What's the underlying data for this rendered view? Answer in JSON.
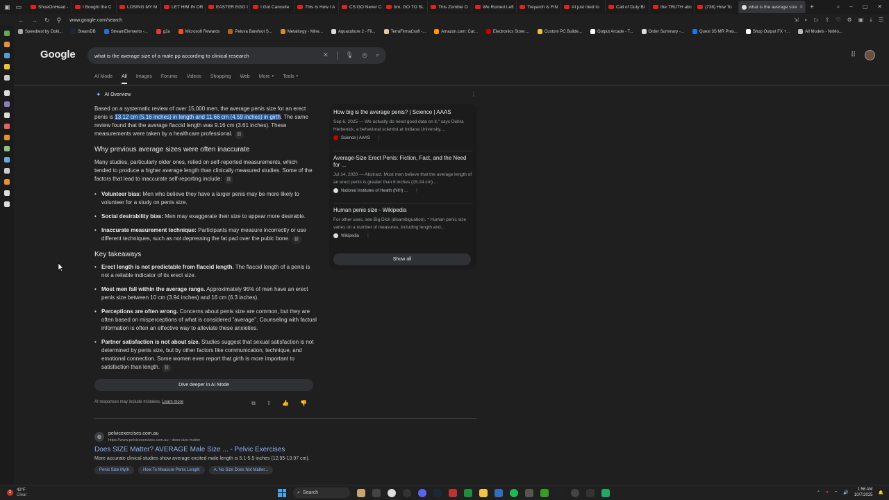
{
  "browser": {
    "tabs": [
      {
        "label": "ShoeOnHead -",
        "icon": "youtube-icon"
      },
      {
        "label": "I Bought the C",
        "icon": "youtube-icon"
      },
      {
        "label": "LOSING MY M",
        "icon": "youtube-icon"
      },
      {
        "label": "LET HIM IN OR",
        "icon": "youtube-icon"
      },
      {
        "label": "EASTER EGG I",
        "icon": "youtube-icon"
      },
      {
        "label": "I Got Cancelle",
        "icon": "youtube-icon"
      },
      {
        "label": "This Is How I A",
        "icon": "youtube-icon"
      },
      {
        "label": "CS:GO Never C",
        "icon": "youtube-icon"
      },
      {
        "label": "bro, GO TO SL",
        "icon": "youtube-icon"
      },
      {
        "label": "This Zombie O",
        "icon": "youtube-icon"
      },
      {
        "label": "We Ruined Left",
        "icon": "youtube-icon"
      },
      {
        "label": "Treyarch is FIN",
        "icon": "youtube-icon"
      },
      {
        "label": "AI just tried to",
        "icon": "youtube-icon"
      },
      {
        "label": "Call of Duty Bl",
        "icon": "youtube-icon"
      },
      {
        "label": "the TRUTH abc",
        "icon": "youtube-icon"
      },
      {
        "label": "(738) How To",
        "icon": "youtube-icon"
      },
      {
        "label": "what is the average size",
        "icon": "google-icon",
        "active": true
      }
    ],
    "url": "www.google.com/search",
    "bookmarks": [
      "Speedtest by Ookl...",
      "SteamDB",
      "StreamElements -...",
      "g2a",
      "Microsoft Rewards",
      "Peluva Barefoot S...",
      "Metallurgy - Mine...",
      "Aquaculture 2 - Fil...",
      "TerraFirmaCraft -...",
      "Amazon.com: Cat...",
      "Electronics Store:...",
      "Custom PC Builde...",
      "Output Arcade - T...",
      "Order Summary -...",
      "Quest 3S MR Pres...",
      "Shop Output FX +...",
      "All Models - NxMo..."
    ]
  },
  "google": {
    "logo": "Google",
    "query": "what is the average size of a male pp according to clinical research",
    "tabs": [
      "AI Mode",
      "All",
      "Images",
      "Forums",
      "Videos",
      "Shopping",
      "Web",
      "More",
      "Tools"
    ],
    "active_tab": "All"
  },
  "ai_overview": {
    "label": "AI Overview",
    "intro_before": "Based on a systematic review of over 15,000 men, the average penis size for an erect penis is ",
    "intro_highlight": "13.12 cm (5.16 inches) in length and 11.66 cm (4.59 inches) in girth",
    "intro_after": ". The same review found that the average flaccid length was 9.16 cm (3.61 inches). These measurements were taken by a healthcare professional.",
    "section1_title": "Why previous average sizes were often inaccurate",
    "section1_text": "Many studies, particularly older ones, relied on self-reported measurements, which tended to produce a higher average length than clinically measured studies. Some of the factors that lead to inaccurate self-reporting include:",
    "bias_items": [
      {
        "bold": "Volunteer bias:",
        "text": " Men who believe they have a larger penis may be more likely to volunteer for a study on penis size."
      },
      {
        "bold": "Social desirability bias:",
        "text": " Men may exaggerate their size to appear more desirable."
      },
      {
        "bold": "Inaccurate measurement technique:",
        "text": " Participants may measure incorrectly or use different techniques, such as not depressing the fat pad over the pubic bone."
      }
    ],
    "section2_title": "Key takeaways",
    "takeaways": [
      {
        "bold": "Erect length is not predictable from flaccid length.",
        "text": " The flaccid length of a penis is not a reliable indicator of its erect size."
      },
      {
        "bold": "Most men fall within the average range.",
        "text": " Approximately 95% of men have an erect penis size between 10 cm (3.94 inches) and 16 cm (6.3 inches)."
      },
      {
        "bold": "Perceptions are often wrong.",
        "text": " Concerns about penis size are common, but they are often based on misperceptions of what is considered \"average\". Counseling with factual information is often an effective way to alleviate these anxieties."
      },
      {
        "bold": "Partner satisfaction is not about size.",
        "text": " Studies suggest that sexual satisfaction is not determined by penis size, but by other factors like communication, technique, and emotional connection. Some women even report that girth is more important to satisfaction than length."
      }
    ],
    "dive_button": "Dive deeper in AI Mode",
    "disclaimer": "AI responses may include mistakes.",
    "learn_more": "Learn more"
  },
  "sources": [
    {
      "title": "How big is the average penis? | Science | AAAS",
      "snippet": "Sep 6, 2025 — We actually do need good data on it,\" says Debra Herbenick, a behavioral scientist at Indiana University,...",
      "site": "Science | AAAS"
    },
    {
      "title": "Average-Size Erect Penis: Fiction, Fact, and the Need for ...",
      "snippet": "Jul 14, 2020 — Abstract. Most men believe that the average length of an erect penis is greater than 6 inches (15.24 cm)....",
      "site": "National Institutes of Health (NIH) ..."
    },
    {
      "title": "Human penis size - Wikipedia",
      "snippet": "For other uses, see Big Dick (disambiguation). * Human penis size varies on a number of measures, including length and...",
      "site": "Wikipedia"
    }
  ],
  "show_all": "Show all",
  "result": {
    "site": "pelvicexercises.com.au",
    "url": "https://www.pelvicexercises.com.au › does-size-matter",
    "title": "Does SIZE Matter? AVERAGE Male Size ... - Pelvic Exercises",
    "snippet": "More accurate clinical studies show average excited male length is 5.1-5.5 inches (12.95-13.97 cm).",
    "chips": [
      "Penis Size Myth",
      "How To Measure Penis Length",
      "A. No Size Does Not Matter..."
    ]
  },
  "taskbar": {
    "temp": "42°F",
    "weather": "Clear",
    "badge": "2",
    "search": "Search",
    "time": "1:56 AM",
    "date": "10/7/2025"
  }
}
